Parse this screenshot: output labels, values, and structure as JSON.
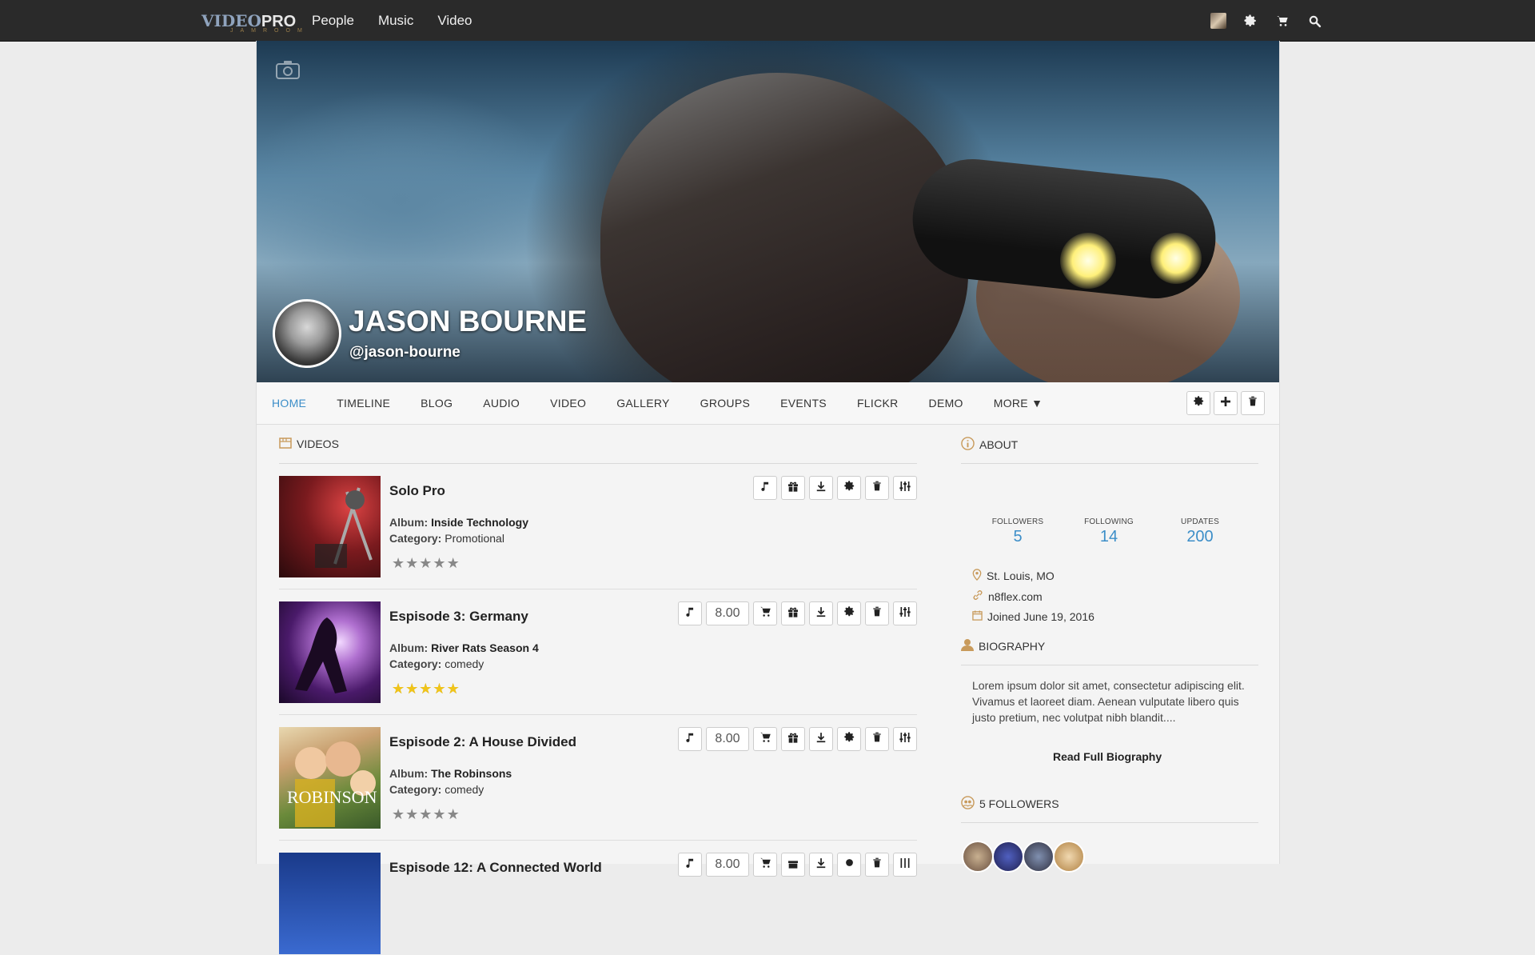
{
  "topbar": {
    "logo_main_a": "VIDEO",
    "logo_main_b": "PRO",
    "logo_sub": "JAMROOM",
    "nav": [
      "People",
      "Music",
      "Video"
    ],
    "icons": [
      "user-avatar-icon",
      "gear-icon",
      "cart-icon",
      "search-icon"
    ]
  },
  "profile": {
    "name": "JASON BOURNE",
    "handle": "@jason-bourne"
  },
  "profile_nav": {
    "items": [
      "HOME",
      "TIMELINE",
      "BLOG",
      "AUDIO",
      "VIDEO",
      "GALLERY",
      "GROUPS",
      "EVENTS",
      "FLICKR",
      "DEMO",
      "MORE ▼"
    ],
    "active": "HOME"
  },
  "videos": {
    "heading": "VIDEOS",
    "album_label": "Album:",
    "category_label": "Category:",
    "items": [
      {
        "title": "Solo Pro",
        "album": "Inside Technology",
        "category": "Promotional",
        "price": "",
        "rating": 0
      },
      {
        "title": "Espisode 3: Germany",
        "album": "River Rats Season 4",
        "category": "comedy",
        "price": "8.00",
        "rating": 5
      },
      {
        "title": "Espisode 2: A House Divided",
        "album": "The Robinsons",
        "category": "comedy",
        "price": "8.00",
        "rating": 0
      },
      {
        "title": "Espisode 12: A Connected World",
        "album": "",
        "category": "",
        "price": "8.00",
        "rating": 0
      }
    ]
  },
  "about": {
    "heading": "ABOUT",
    "stats": [
      {
        "label": "FOLLOWERS",
        "value": "5"
      },
      {
        "label": "FOLLOWING",
        "value": "14"
      },
      {
        "label": "UPDATES",
        "value": "200"
      }
    ],
    "location": "St. Louis, MO",
    "website": "n8flex.com",
    "joined": "Joined June 19, 2016"
  },
  "biography": {
    "heading": "BIOGRAPHY",
    "text": "Lorem ipsum dolor sit amet, consectetur adipiscing elit. Vivamus et laoreet diam. Aenean vulputate libero quis justo pretium, nec volutpat nibh blandit....",
    "link": "Read Full Biography"
  },
  "followers": {
    "heading": "5 FOLLOWERS"
  },
  "colors": {
    "accent": "#3c8ec8",
    "topbar": "#2a2a2a",
    "star_on": "#f0c419",
    "star_off": "#888888"
  }
}
